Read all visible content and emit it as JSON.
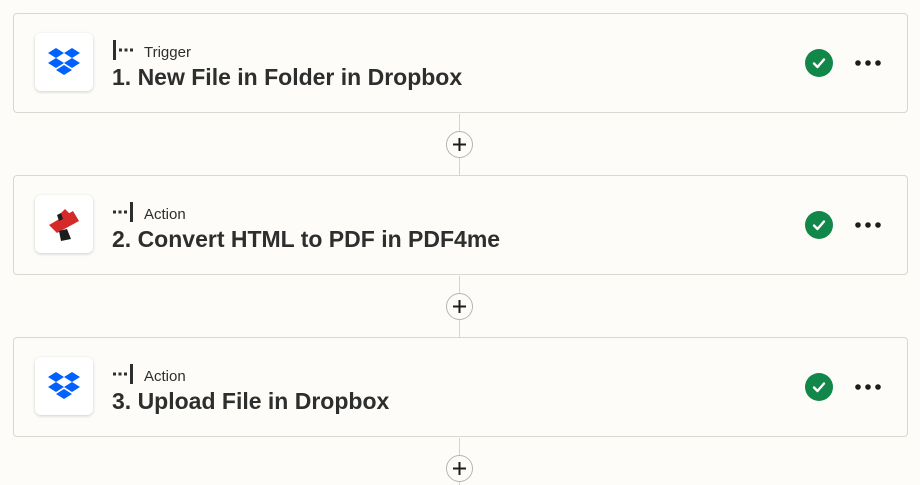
{
  "steps": [
    {
      "type_label": "Trigger",
      "type_icon": "trigger-icon",
      "title": "1. New File in Folder in Dropbox",
      "app_icon": "dropbox-icon",
      "status_icon": "check-circle-icon"
    },
    {
      "type_label": "Action",
      "type_icon": "action-icon",
      "title": "2. Convert HTML to PDF in PDF4me",
      "app_icon": "pdf4me-icon",
      "status_icon": "check-circle-icon"
    },
    {
      "type_label": "Action",
      "type_icon": "action-icon",
      "title": "3. Upload File in Dropbox",
      "app_icon": "dropbox-icon",
      "status_icon": "check-circle-icon"
    }
  ],
  "colors": {
    "background": "#fdfcf8",
    "status_success": "#12874a",
    "dropbox_blue": "#0061fe",
    "pdf4me_red": "#d42a2a"
  }
}
